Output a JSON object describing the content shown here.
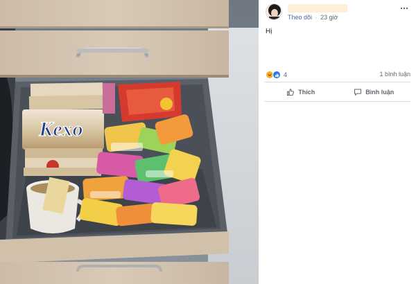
{
  "photo": {
    "description_icon": "photo-of-drawer-with-snacks",
    "package_brand": "Kexo"
  },
  "post": {
    "meta": {
      "follow_label": "Theo dõi",
      "separator": "·",
      "time": "23 giờ"
    },
    "text": "Hị",
    "reactions": {
      "icons": [
        "haha-icon",
        "like-icon"
      ],
      "count": "4"
    },
    "comments_count": "1 bình luận",
    "actions": {
      "like_label": "Thích",
      "comment_label": "Bình luận"
    },
    "more_icon": "more-icon"
  },
  "colors": {
    "link": "#4b67a1",
    "secondary_text": "#606770",
    "like_blue": "#2078f4",
    "haha_yellow": "#f7b125"
  }
}
